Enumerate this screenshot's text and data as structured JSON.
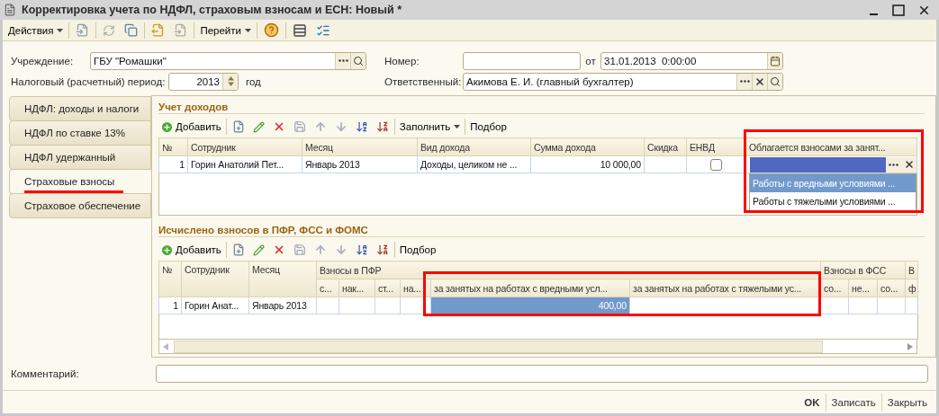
{
  "window": {
    "title": "Корректировка учета по НДФЛ, страховым взносам и ЕСН: Новый *"
  },
  "toolbar": {
    "actions": "Действия",
    "goto": "Перейти"
  },
  "header": {
    "institution": {
      "label": "Учреждение:",
      "value": "ГБУ \"Ромашки\""
    },
    "number": {
      "label": "Номер:"
    },
    "date": {
      "label": "от",
      "value": "31.01.2013  0:00:00"
    },
    "period": {
      "label": "Налоговый (расчетный) период:",
      "value": "2013",
      "unit": "год"
    },
    "responsible": {
      "label": "Ответственный:",
      "value": "Акимова Е. И. (главный бухгалтер)"
    }
  },
  "tabs": [
    {
      "label": "НДФЛ: доходы и налоги",
      "selected": false
    },
    {
      "label": "НДФЛ по ставке 13%",
      "selected": false
    },
    {
      "label": "НДФЛ удержанный",
      "selected": false
    },
    {
      "label": "Страховые взносы",
      "selected": true
    },
    {
      "label": "Страховое обеспечение",
      "selected": false
    }
  ],
  "income": {
    "title": "Учет доходов",
    "add": "Добавить",
    "fill": "Заполнить",
    "select": "Подбор",
    "columns": [
      {
        "label": "№",
        "kind": "index"
      },
      {
        "label": "Сотрудник",
        "kind": "text"
      },
      {
        "label": "Месяц",
        "kind": "text"
      },
      {
        "label": "Вид дохода",
        "kind": "text"
      },
      {
        "label": "Сумма дохода",
        "kind": "money"
      },
      {
        "label": "Скидка",
        "kind": "money"
      },
      {
        "label": "ЕНВД",
        "kind": "check"
      },
      {
        "label": "Облагается взносами за занят...",
        "kind": "ref"
      }
    ],
    "rows": [
      {
        "cells": [
          {
            "text": "1"
          },
          {
            "text": "Горин Анатолий Пет..."
          },
          {
            "text": "Январь 2013"
          },
          {
            "text": "Доходы, целиком не ..."
          },
          {
            "text": "10 000,00"
          },
          {},
          {
            "checked": false
          },
          {
            "selected": true
          }
        ]
      }
    ],
    "dropdown": [
      {
        "label": "Работы с вредными условиями ...",
        "selected": true
      },
      {
        "label": "Работы с тяжелыми условиями ...",
        "selected": false
      }
    ]
  },
  "contributions": {
    "title": "Исчислено взносов в ПФР, ФСС и ФОМС",
    "add": "Добавить",
    "select": "Подбор",
    "columns": [
      {
        "label": "№",
        "kind": "index"
      },
      {
        "label": "Сотрудник",
        "kind": "text"
      },
      {
        "label": "Месяц",
        "kind": "text"
      }
    ],
    "groups": [
      {
        "label": "Взносы в ПФР",
        "columns": [
          {
            "label": "с...",
            "kind": "money"
          },
          {
            "label": "нак...",
            "kind": "money"
          },
          {
            "label": "ст...",
            "kind": "money"
          },
          {
            "label": "на...",
            "kind": "money"
          },
          {
            "label": "за занятых на работах с вредными усл...",
            "kind": "money"
          },
          {
            "label": "за занятых на работах с тяжелыми ус...",
            "kind": "money"
          }
        ]
      },
      {
        "label": "Взносы в ФСС",
        "columns": [
          {
            "label": "со...",
            "kind": "money"
          },
          {
            "label": "не...",
            "kind": "money"
          },
          {
            "label": "со...",
            "kind": "money"
          }
        ]
      },
      {
        "label": "В",
        "columns": [
          {
            "label": "ф",
            "kind": "money"
          }
        ]
      }
    ],
    "rows": [
      {
        "cells": [
          {
            "text": "1"
          },
          {
            "text": "Горин Анат..."
          },
          {
            "text": "Январь 2013"
          },
          {},
          {},
          {},
          {},
          {
            "text": "400,00",
            "selected": true
          },
          {},
          {},
          {},
          {},
          {}
        ]
      }
    ]
  },
  "comment": {
    "label": "Комментарий:"
  },
  "buttons": [
    {
      "label": "OK",
      "kind": "default"
    },
    {
      "label": "Записать",
      "kind": "plain"
    },
    {
      "label": "Закрыть",
      "kind": "plain"
    }
  ]
}
